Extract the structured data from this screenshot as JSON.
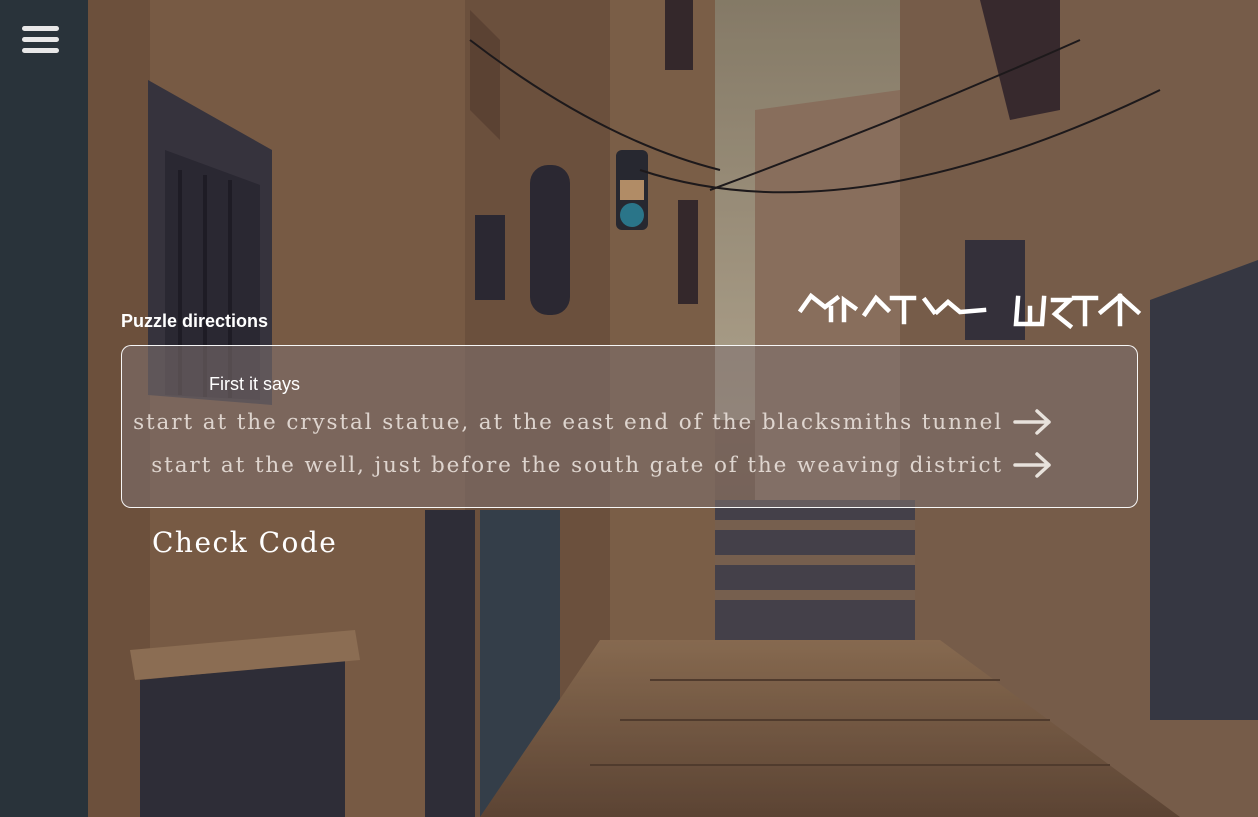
{
  "menu": {
    "icon": "hamburger-menu-icon"
  },
  "cipher_title": {
    "icon": "cipher-rune-title"
  },
  "puzzle": {
    "label": "Puzzle directions",
    "intro": "First it says",
    "directions": [
      "start at the crystal statue, at the east end of the blacksmiths tunnel",
      "start at the well, just before the south gate of the weaving district"
    ],
    "direction_icon": "arrow-right-icon"
  },
  "check_code_label": "Check Code",
  "colors": {
    "panel_border": "#ffffff",
    "text": "#ffffff",
    "direction_text": "#ece4de"
  }
}
